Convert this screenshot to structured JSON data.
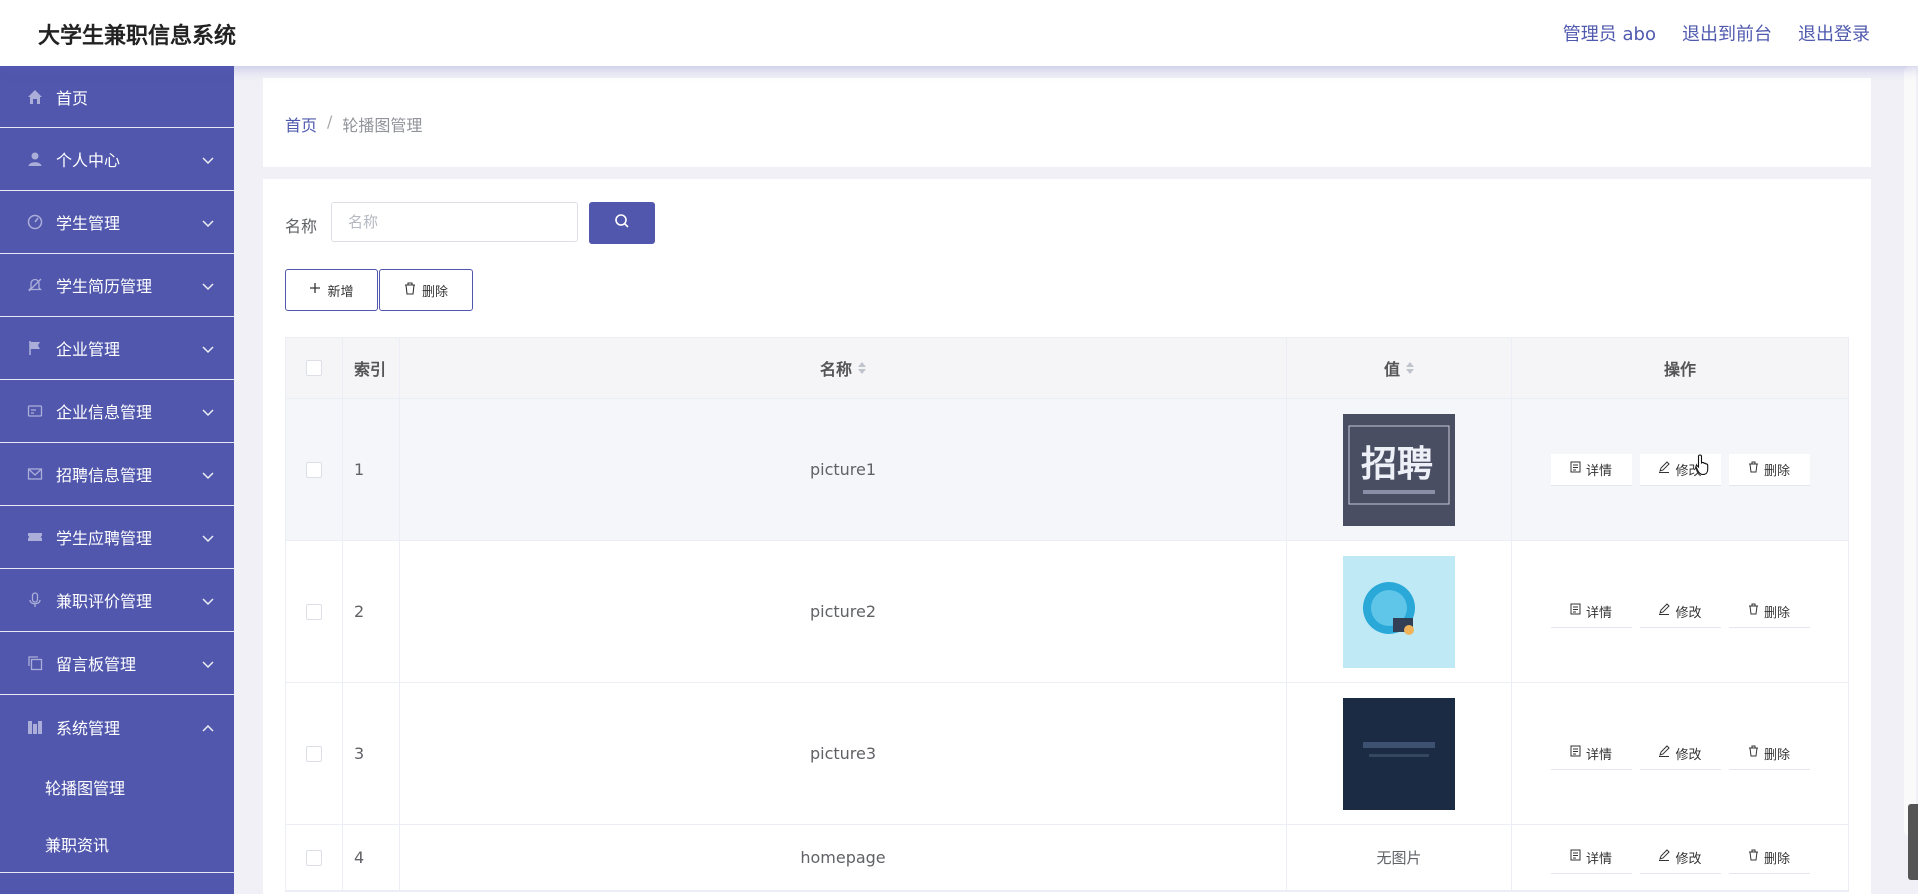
{
  "app": {
    "title": "大学生兼职信息系统"
  },
  "header": {
    "user": "管理员 abo",
    "to_front": "退出到前台",
    "logout": "退出登录"
  },
  "sidebar": {
    "items": [
      {
        "label": "首页",
        "icon": "home-icon"
      },
      {
        "label": "个人中心",
        "icon": "user-icon"
      },
      {
        "label": "学生管理",
        "icon": "dashboard-icon"
      },
      {
        "label": "学生简历管理",
        "icon": "bell-off-icon"
      },
      {
        "label": "企业管理",
        "icon": "flag-icon"
      },
      {
        "label": "企业信息管理",
        "icon": "card-icon"
      },
      {
        "label": "招聘信息管理",
        "icon": "mail-icon"
      },
      {
        "label": "学生应聘管理",
        "icon": "ticket-icon"
      },
      {
        "label": "兼职评价管理",
        "icon": "microphone-icon"
      },
      {
        "label": "留言板管理",
        "icon": "copy-icon"
      },
      {
        "label": "系统管理",
        "icon": "chart-icon"
      }
    ],
    "sub_items": [
      {
        "label": "轮播图管理"
      },
      {
        "label": "兼职资讯"
      }
    ]
  },
  "breadcrumb": {
    "home": "首页",
    "separator": "/",
    "current": "轮播图管理"
  },
  "search": {
    "label": "名称",
    "placeholder": "名称"
  },
  "toolbar": {
    "add_label": "新增",
    "delete_label": "删除"
  },
  "table": {
    "headers": {
      "index": "索引",
      "name": "名称",
      "value": "值",
      "ops": "操作"
    },
    "rows": [
      {
        "index": "1",
        "name": "picture1",
        "value_type": "image",
        "thumb": "recruit-banner"
      },
      {
        "index": "2",
        "name": "picture2",
        "value_type": "image",
        "thumb": "blue-illustration"
      },
      {
        "index": "3",
        "name": "picture3",
        "value_type": "image",
        "thumb": "dark-banner"
      },
      {
        "index": "4",
        "name": "homepage",
        "value_type": "text",
        "value": "无图片"
      }
    ],
    "actions": {
      "detail": "详情",
      "edit": "修改",
      "delete": "删除"
    }
  },
  "thumb_text": {
    "big": "招聘"
  },
  "colors": {
    "primary": "#5157ad",
    "sidebar": "#5157ad",
    "background": "#f0f0f6"
  }
}
